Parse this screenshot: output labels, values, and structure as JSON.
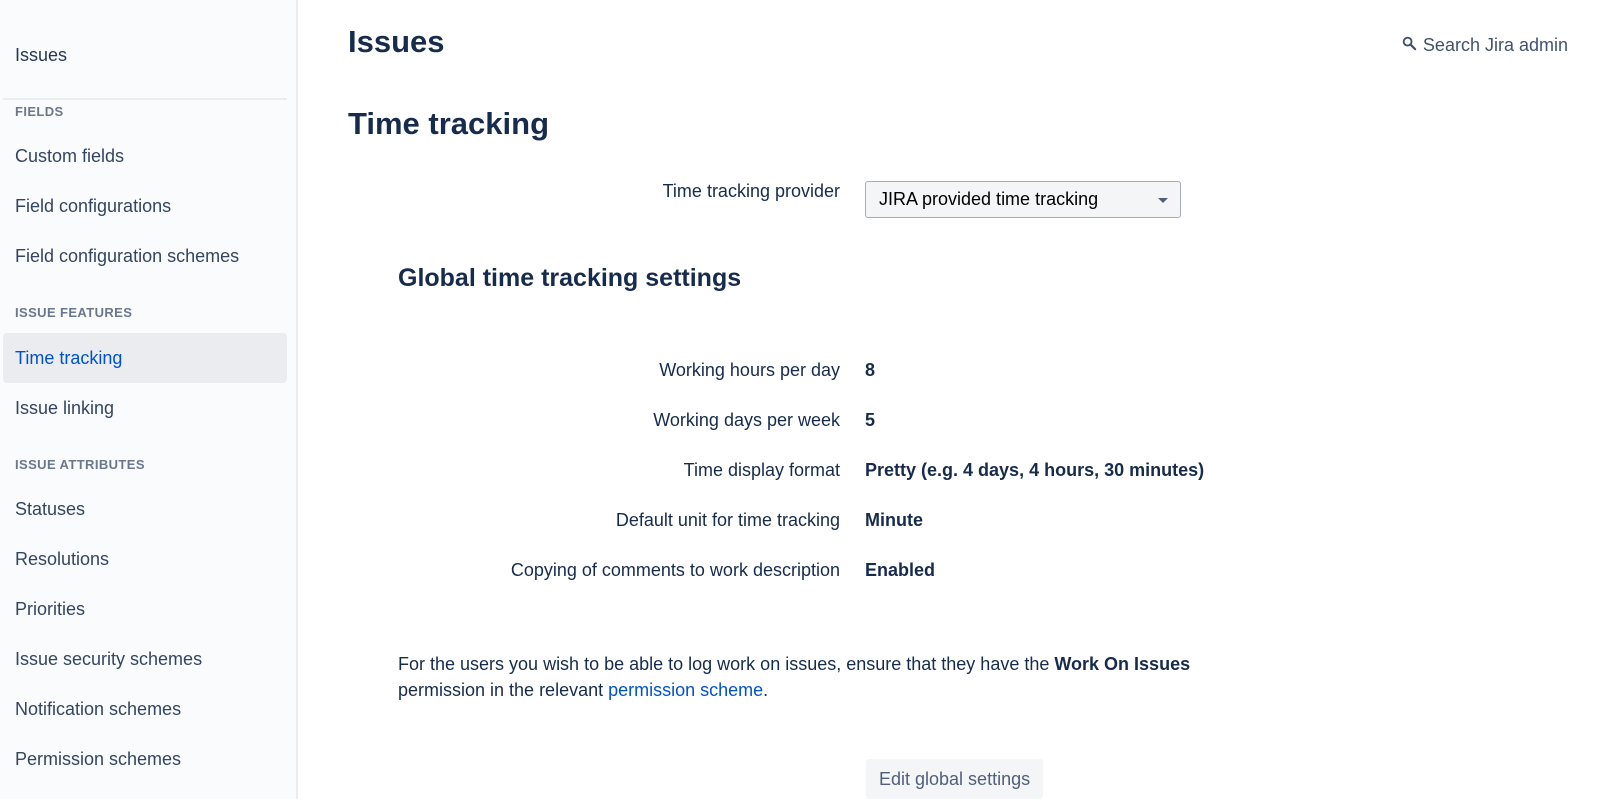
{
  "sidebar": {
    "title": "Issues",
    "sections": [
      {
        "label": "FIELDS",
        "items": [
          {
            "label": "Custom fields",
            "active": false
          },
          {
            "label": "Field configurations",
            "active": false
          },
          {
            "label": "Field configuration schemes",
            "active": false
          }
        ]
      },
      {
        "label": "ISSUE FEATURES",
        "items": [
          {
            "label": "Time tracking",
            "active": true
          },
          {
            "label": "Issue linking",
            "active": false
          }
        ]
      },
      {
        "label": "ISSUE ATTRIBUTES",
        "items": [
          {
            "label": "Statuses",
            "active": false
          },
          {
            "label": "Resolutions",
            "active": false
          },
          {
            "label": "Priorities",
            "active": false
          },
          {
            "label": "Issue security schemes",
            "active": false
          },
          {
            "label": "Notification schemes",
            "active": false
          },
          {
            "label": "Permission schemes",
            "active": false
          }
        ]
      }
    ]
  },
  "header": {
    "title": "Issues",
    "search_label": "Search Jira admin",
    "search_icon": "search-icon"
  },
  "main": {
    "page_title": "Time tracking",
    "provider": {
      "label": "Time tracking provider",
      "selected": "JIRA provided time tracking"
    },
    "global_settings": {
      "heading": "Global time tracking settings",
      "rows": [
        {
          "label": "Working hours per day",
          "value": "8"
        },
        {
          "label": "Working days per week",
          "value": "5"
        },
        {
          "label": "Time display format",
          "value": "Pretty (e.g. 4 days, 4 hours, 30 minutes)"
        },
        {
          "label": "Default unit for time tracking",
          "value": "Minute"
        },
        {
          "label": "Copying of comments to work description",
          "value": "Enabled"
        }
      ]
    },
    "info": {
      "text_before": "For the users you wish to be able to log work on issues, ensure that they have the ",
      "bold": "Work On Issues",
      "text_middle": " permission in the relevant ",
      "link": "permission scheme",
      "text_after": "."
    },
    "edit_button": "Edit global settings"
  },
  "colors": {
    "link": "#0052cc",
    "text": "#172b4d",
    "sidebar_bg": "#fafbfc",
    "active_bg": "#ebecf0",
    "muted": "#6b778c"
  }
}
